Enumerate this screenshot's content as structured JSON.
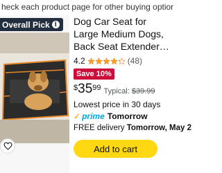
{
  "banner": {
    "text": "heck each product page for other buying options."
  },
  "product": {
    "badge": "Overall Pick",
    "title": "Dog Car Seat for Large Medium Dogs, Back Seat Extender with Waterproof...",
    "rating": "4.2",
    "rating_value": 4.2,
    "reviews": "(48)",
    "save_label": "Save 10%",
    "price_symbol": "$",
    "price_whole": "35",
    "price_fraction": "99",
    "typical_label": "Typical:",
    "typical_price": "$39.99",
    "lowest_price_note": "Lowest price in 30 days",
    "prime_word": "prime",
    "prime_delivery": "Tomorrow",
    "delivery_prefix": "FREE delivery",
    "delivery_date": "Tomorrow, May 2",
    "add_to_cart_label": "Add to cart"
  },
  "colors": {
    "badge_bg": "#232f3e",
    "save_badge_bg": "#cc0c39",
    "star": "#ffa41c",
    "prime_blue": "#00a8e1",
    "add_to_cart_bg": "#ffd814"
  },
  "icons": {
    "info": "info-icon",
    "heart": "heart-outline-icon",
    "prime_check": "check-icon",
    "star": "star-icon"
  }
}
